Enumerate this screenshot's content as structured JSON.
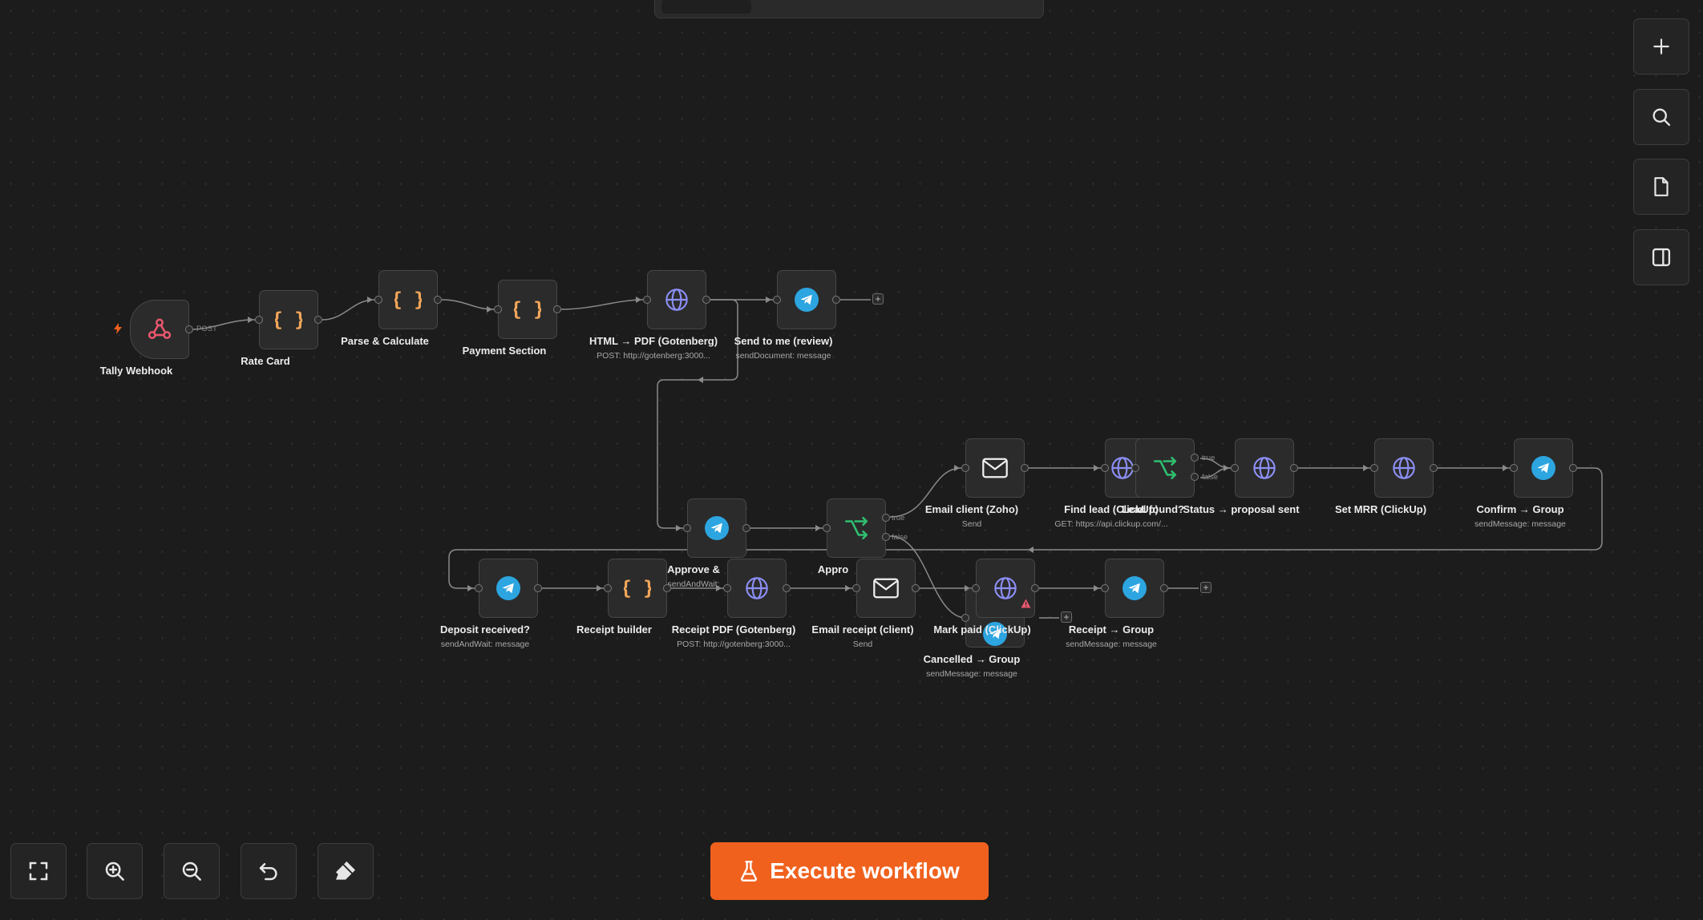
{
  "canvas": {
    "nodes": [
      {
        "id": "tally",
        "label": "Tally Webhook",
        "sub": "",
        "icon": "webhook-icon"
      },
      {
        "id": "rate",
        "label": "Rate Card",
        "sub": "",
        "icon": "code-braces-icon"
      },
      {
        "id": "parse",
        "label": "Parse & Calculate",
        "sub": "",
        "icon": "code-braces-icon"
      },
      {
        "id": "payment",
        "label": "Payment Section",
        "sub": "",
        "icon": "code-braces-icon"
      },
      {
        "id": "html_pdf",
        "label": "HTML → PDF (Gotenberg)",
        "sub": "POST: http://gotenberg:3000...",
        "icon": "globe-icon"
      },
      {
        "id": "send_me",
        "label": "Send to me (review)",
        "sub": "sendDocument: message",
        "icon": "telegram-icon"
      },
      {
        "id": "approve_send",
        "label": "Approve &",
        "sub": "sendAndWait:",
        "icon": "telegram-icon"
      },
      {
        "id": "approved_if",
        "label": "Appro",
        "sub": "",
        "icon": "branch-icon"
      },
      {
        "id": "email_client",
        "label": "Email client (Zoho)",
        "sub": "Send",
        "icon": "mail-icon"
      },
      {
        "id": "find_lead",
        "label": "Find lead (ClickUp)",
        "sub": "GET: https://api.clickup.com/...",
        "icon": "globe-icon"
      },
      {
        "id": "lead_found",
        "label": "Lead found?",
        "sub": "",
        "icon": "branch-icon"
      },
      {
        "id": "status_sent",
        "label": "Status → proposal sent",
        "sub": "",
        "icon": "globe-icon"
      },
      {
        "id": "set_mrr",
        "label": "Set MRR (ClickUp)",
        "sub": "",
        "icon": "globe-icon"
      },
      {
        "id": "confirm_group",
        "label": "Confirm → Group",
        "sub": "sendMessage: message",
        "icon": "telegram-icon"
      },
      {
        "id": "deposit",
        "label": "Deposit received?",
        "sub": "sendAndWait: message",
        "icon": "telegram-icon"
      },
      {
        "id": "receipt_builder",
        "label": "Receipt builder",
        "sub": "",
        "icon": "code-braces-icon"
      },
      {
        "id": "receipt_pdf",
        "label": "Receipt PDF (Gotenberg)",
        "sub": "POST: http://gotenberg:3000...",
        "icon": "globe-icon"
      },
      {
        "id": "email_receipt",
        "label": "Email receipt (client)",
        "sub": "Send",
        "icon": "mail-icon"
      },
      {
        "id": "cancelled_group",
        "label": "Cancelled → Group",
        "sub": "sendMessage: message",
        "icon": "telegram-icon"
      },
      {
        "id": "mark_paid",
        "label": "Mark paid (ClickUp)",
        "sub": "",
        "icon": "globe-icon"
      },
      {
        "id": "receipt_group",
        "label": "Receipt → Group",
        "sub": "sendMessage: message",
        "icon": "telegram-icon"
      }
    ],
    "edge_labels": {
      "post": "POST",
      "true_a": "true",
      "false_a": "false",
      "true_b": "true",
      "false_b": "false"
    }
  },
  "side_toolbar": [
    {
      "icon": "plus-icon",
      "name": "add-node-button"
    },
    {
      "icon": "search-icon",
      "name": "search-button"
    },
    {
      "icon": "sticky-note-icon",
      "name": "add-sticky-note-button"
    },
    {
      "icon": "panel-icon",
      "name": "toggle-panel-button"
    }
  ],
  "bottom_toolbar": [
    {
      "icon": "fit-view-icon",
      "name": "fit-view-button"
    },
    {
      "icon": "zoom-in-icon",
      "name": "zoom-in-button"
    },
    {
      "icon": "zoom-out-icon",
      "name": "zoom-out-button"
    },
    {
      "icon": "undo-icon",
      "name": "undo-button"
    },
    {
      "icon": "tidy-up-icon",
      "name": "tidy-up-button"
    }
  ],
  "execute": {
    "label": "Execute workflow",
    "icon": "flask-icon",
    "color": "#f0611e"
  },
  "colors": {
    "braces": "#f2a65a",
    "globe": "#8c8ff5",
    "telegram": "#2ca5e0",
    "branch": "#2fbf71",
    "webhook": "#e8576e",
    "trigger": "#f0611e"
  }
}
